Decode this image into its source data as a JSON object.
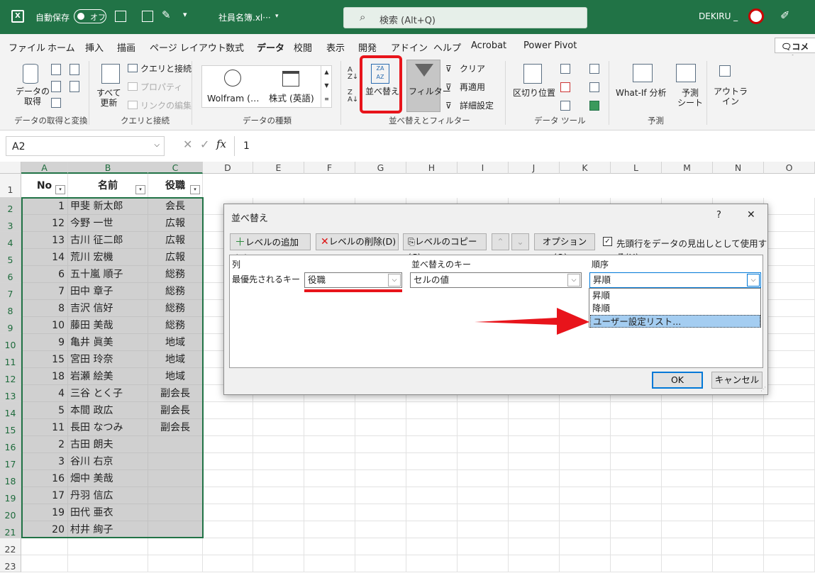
{
  "titlebar": {
    "autosave": "自動保存",
    "toggle": "オフ",
    "filename": "社員名簿.xl···",
    "search": "検索 (Alt+Q)",
    "user": "DEKIRU _"
  },
  "menu": [
    "ファイル",
    "ホーム",
    "挿入",
    "描画",
    "ページ レイアウト",
    "数式",
    "データ",
    "校閲",
    "表示",
    "開発",
    "アドイン",
    "ヘルプ",
    "Acrobat",
    "Power Pivot"
  ],
  "comment_button": "コメント",
  "ribbon": {
    "get_data": "データの\n取得",
    "refresh_all": "すべて\n更新",
    "queries": "クエリと接続",
    "properties": "プロパティ",
    "edit_links": "リンクの編集",
    "wolfram": "Wolfram (…",
    "stocks": "株式 (英語)",
    "sort": "並べ替え",
    "filter": "フィルター",
    "clear": "クリア",
    "reapply": "再適用",
    "advanced": "詳細設定",
    "text_to_columns": "区切り位置",
    "whatif": "What-If 分析",
    "forecast_sheet": "予測\nシート",
    "outline": "アウトラ\nイン",
    "groups": [
      "データの取得と変換",
      "クエリと接続",
      "データの種類",
      "並べ替えとフィルター",
      "データ ツール",
      "予測"
    ]
  },
  "formula_bar": {
    "name_box": "A2",
    "formula": "1",
    "fx": "fx"
  },
  "columns": [
    "A",
    "B",
    "C",
    "D",
    "E",
    "F",
    "G",
    "H",
    "I",
    "J",
    "K",
    "L",
    "M",
    "N",
    "O"
  ],
  "rows": [
    "1",
    "2",
    "3",
    "4",
    "5",
    "6",
    "7",
    "8",
    "9",
    "10",
    "11",
    "12",
    "13",
    "14",
    "15",
    "16",
    "17",
    "18",
    "19",
    "20",
    "21",
    "22",
    "23"
  ],
  "table": {
    "headers": [
      "No",
      "名前",
      "役職"
    ],
    "data": [
      [
        "1",
        "甲斐 新太郎",
        "会長"
      ],
      [
        "12",
        "今野 一世",
        "広報"
      ],
      [
        "13",
        "古川 征二郎",
        "広報"
      ],
      [
        "14",
        "荒川 宏機",
        "広報"
      ],
      [
        "6",
        "五十嵐 順子",
        "総務"
      ],
      [
        "7",
        "田中 章子",
        "総務"
      ],
      [
        "8",
        "吉沢 信好",
        "総務"
      ],
      [
        "10",
        "藤田 美哉",
        "総務"
      ],
      [
        "9",
        "亀井 眞美",
        "地域"
      ],
      [
        "15",
        "宮田 玲奈",
        "地域"
      ],
      [
        "18",
        "岩瀬 絵美",
        "地域"
      ],
      [
        "4",
        "三谷 とく子",
        "副会長"
      ],
      [
        "5",
        "本間 政広",
        "副会長"
      ],
      [
        "11",
        "長田 なつみ",
        "副会長"
      ],
      [
        "2",
        "古田 朗夫",
        ""
      ],
      [
        "3",
        "谷川 右京",
        ""
      ],
      [
        "16",
        "畑中 美哉",
        ""
      ],
      [
        "17",
        "丹羽 信広",
        ""
      ],
      [
        "19",
        "田代 亜衣",
        ""
      ],
      [
        "20",
        "村井 絢子",
        ""
      ]
    ]
  },
  "dialog": {
    "title": "並べ替え",
    "help": "?",
    "close": "✕",
    "add_level": "レベルの追加(A)",
    "delete_level": "レベルの削除(D)",
    "copy_level": "レベルのコピー(C)",
    "options": "オプション(O)...",
    "header_checkbox": "先頭行をデータの見出しとして使用する(H)",
    "col_label": "列",
    "key_label": "並べ替えのキー",
    "order_label": "順序",
    "row_label": "最優先されるキー",
    "col_value": "役職",
    "key_value": "セルの値",
    "order_value": "昇順",
    "order_options": [
      "昇順",
      "降順",
      "ユーザー設定リスト..."
    ],
    "ok": "OK",
    "cancel": "キャンセル"
  },
  "colors": {
    "excel_green": "#217346",
    "highlight_red": "#e8141b",
    "selection_gray": "#d0d0d0",
    "list_highlight": "#a4cdf1"
  }
}
